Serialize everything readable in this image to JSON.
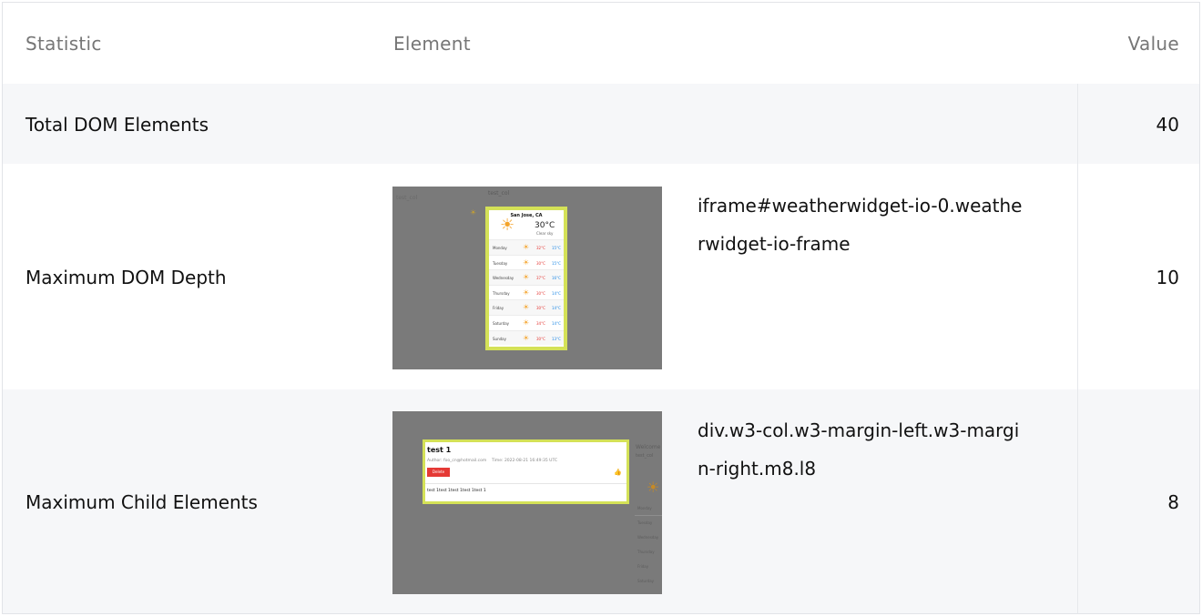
{
  "table": {
    "headers": {
      "statistic": "Statistic",
      "element": "Element",
      "value": "Value"
    },
    "rows": [
      {
        "statistic": "Total DOM Elements",
        "element": "",
        "value": "40"
      },
      {
        "statistic": "Maximum DOM Depth",
        "element": "iframe#weatherwidget-io-0.weatherwidget-io-frame",
        "value": "10"
      },
      {
        "statistic": "Maximum Child Elements",
        "element": "div.w3-col.w3-margin-left.w3-margin-right.m8.l8",
        "value": "8"
      }
    ]
  },
  "weather_thumbnail": {
    "corner_text": "test_col",
    "top_text": "test_col",
    "city": "San Jose, CA",
    "temp": "30°C",
    "condition": "Clear sky",
    "days": [
      {
        "day": "Monday",
        "high": "32°C",
        "low": "15°C"
      },
      {
        "day": "Tuesday",
        "high": "30°C",
        "low": "15°C"
      },
      {
        "day": "Wednesday",
        "high": "37°C",
        "low": "16°C"
      },
      {
        "day": "Thursday",
        "high": "30°C",
        "low": "14°C"
      },
      {
        "day": "Friday",
        "high": "30°C",
        "low": "14°C"
      },
      {
        "day": "Saturday",
        "high": "34°C",
        "low": "14°C"
      },
      {
        "day": "Sunday",
        "high": "30°C",
        "low": "13°C"
      }
    ]
  },
  "post_thumbnail": {
    "title": "test 1",
    "author": "Author: foo_cn@hotmail.com",
    "time": "Time: 2022-08-21 16:49:35 UTC",
    "button": "Delete",
    "body": "test 1test 1test 1test 1test 1",
    "side_title": "Welcome",
    "side_sub": "test_col",
    "side_items": [
      "Monday",
      "Tuesday",
      "Wednesday",
      "Thursday",
      "Friday",
      "Saturday"
    ]
  },
  "colors": {
    "row_alt": "#f6f7f9",
    "thumb_bg": "#7a7a7a",
    "highlight": "#d4e157",
    "delete": "#e53935",
    "sun": "#f4a32a"
  },
  "icons": [
    "sun-icon",
    "thumbs-up-icon"
  ]
}
